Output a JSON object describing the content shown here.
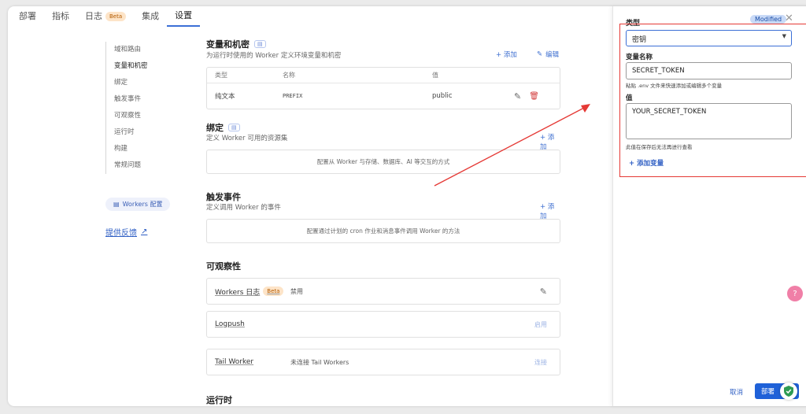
{
  "tabs": [
    {
      "label": "部署"
    },
    {
      "label": "指标"
    },
    {
      "label": "日志",
      "badge": "Beta"
    },
    {
      "label": "集成"
    },
    {
      "label": "设置",
      "active": true
    }
  ],
  "leftnav": {
    "items": [
      "域和路由",
      "变量和机密",
      "绑定",
      "触发事件",
      "可观察性",
      "运行时",
      "构建",
      "常规问题"
    ],
    "workers_badge": "Workers 配置",
    "feedback": "提供反馈"
  },
  "variables": {
    "title": "变量和机密",
    "desc": "为运行时使用的 Worker 定义环境变量和机密",
    "add": "+ 添加",
    "edit": "编辑",
    "headers": [
      "类型",
      "名称",
      "值"
    ],
    "rows": [
      {
        "type": "纯文本",
        "name": "PREFIX",
        "value": "public"
      }
    ]
  },
  "bindings": {
    "title": "绑定",
    "desc": "定义 Worker 可用的资源集",
    "add": "+ 添加",
    "empty": "配置从 Worker 与存储、数据库、AI 等交互的方式"
  },
  "triggers": {
    "title": "触发事件",
    "desc": "定义调用 Worker 的事件",
    "add": "+ 添加",
    "empty": "配置通过计划的 cron 作业和消息事件调用 Worker 的方法"
  },
  "observability": {
    "title": "可观察性",
    "items": [
      {
        "name": "Workers 日志",
        "badge": "Beta",
        "value": "禁用",
        "action": ""
      },
      {
        "name": "Logpush",
        "value": "",
        "action": "启用"
      },
      {
        "name": "Tail Worker",
        "value": "未连接 Tail Workers",
        "action": "连接"
      }
    ]
  },
  "runtime": {
    "title": "运行时"
  },
  "panel": {
    "type_label": "类型",
    "modified": "Modified",
    "type_value": "密钥",
    "name_label": "变量名称",
    "name_value": "SECRET_TOKEN",
    "name_hint": "粘贴 .env 文件来快速添加或编辑多个变量",
    "value_label": "值",
    "value_value": "YOUR_SECRET_TOKEN",
    "value_hint": "此值在保存后无法再进行查看",
    "add_variable": "+ 添加变量",
    "cancel": "取消",
    "deploy": "部署"
  },
  "colors": {
    "accent": "#1f61d8",
    "highlight": "#e53935"
  }
}
